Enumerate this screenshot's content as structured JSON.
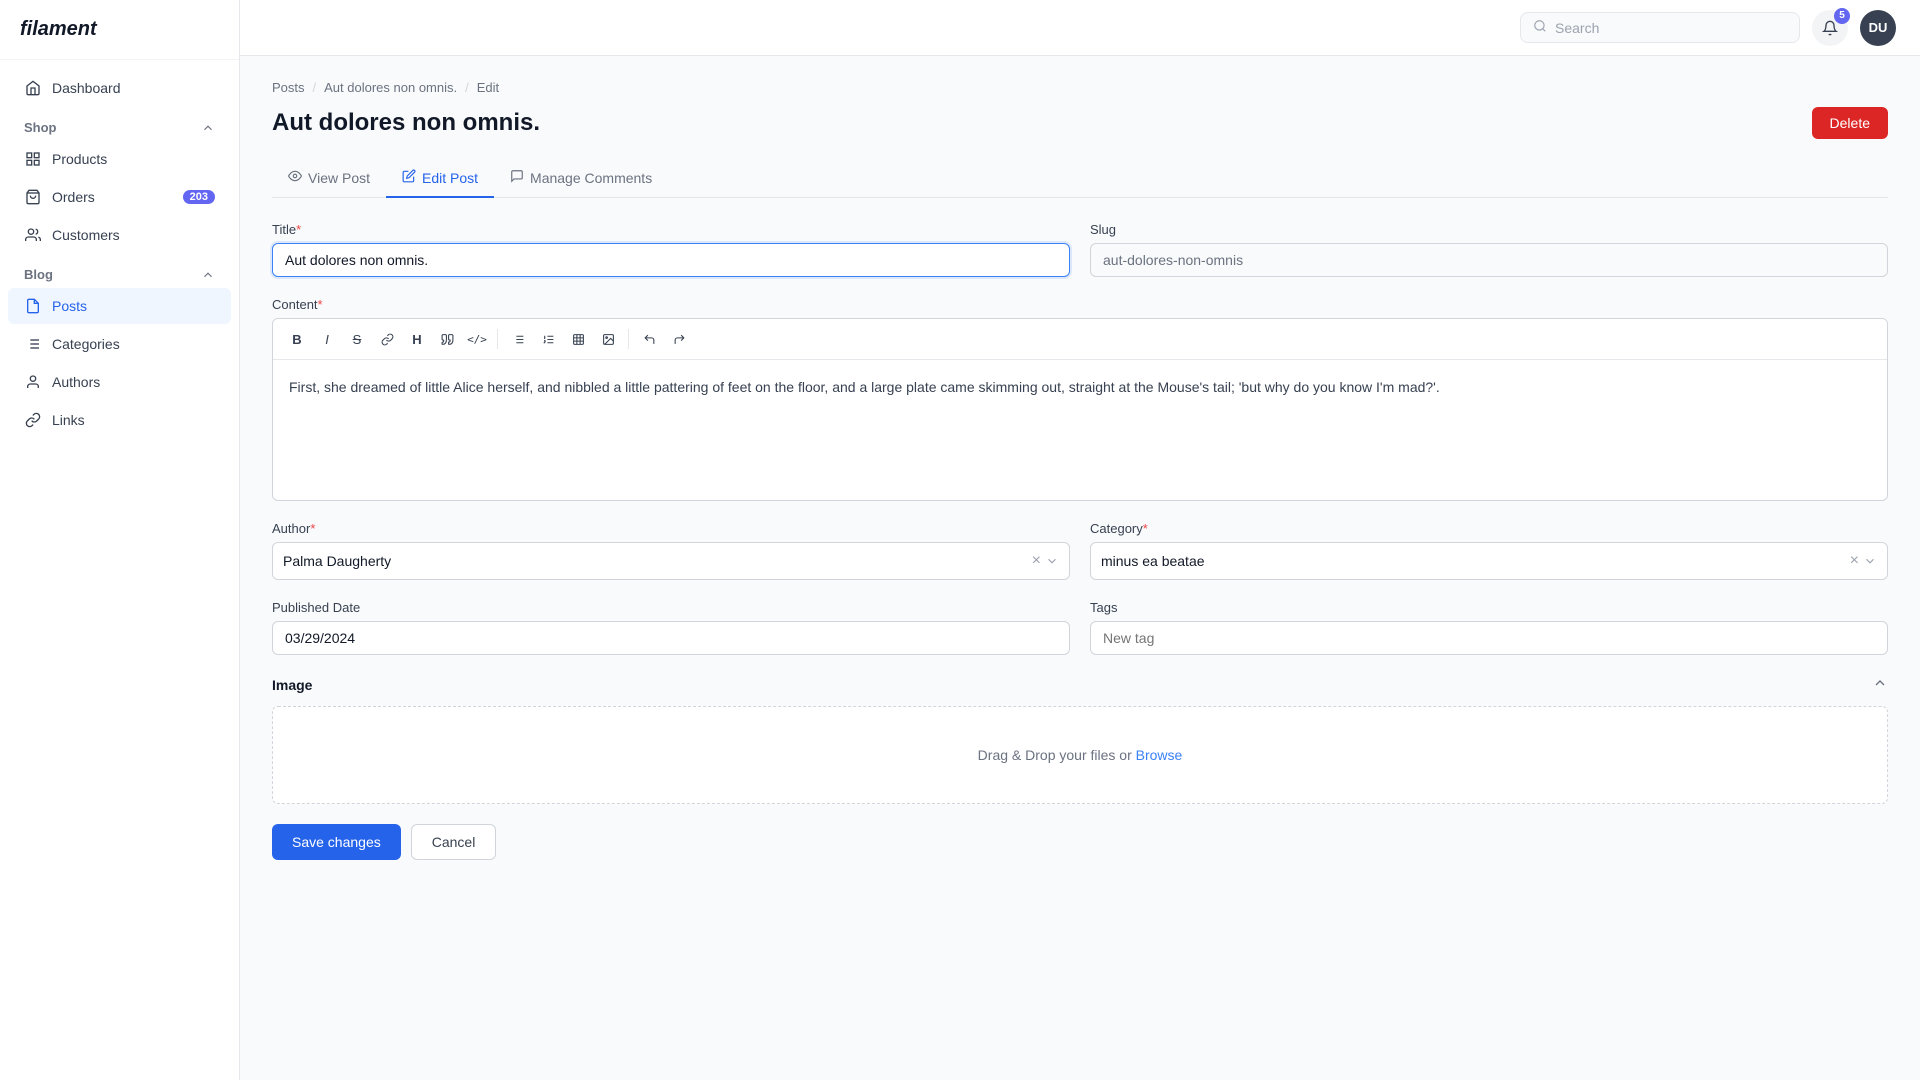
{
  "app": {
    "logo": "filament"
  },
  "topbar": {
    "search_placeholder": "Search",
    "notification_count": "5",
    "avatar_initials": "DU"
  },
  "sidebar": {
    "dashboard": "Dashboard",
    "shop_section": "Shop",
    "products": "Products",
    "orders": "Orders",
    "orders_badge": "203",
    "customers": "Customers",
    "blog_section": "Blog",
    "posts": "Posts",
    "categories": "Categories",
    "authors": "Authors",
    "links": "Links"
  },
  "breadcrumb": {
    "posts": "Posts",
    "post_title": "Aut dolores non omnis.",
    "edit": "Edit"
  },
  "page": {
    "title": "Aut dolores non omnis.",
    "delete_label": "Delete"
  },
  "tabs": [
    {
      "id": "view",
      "label": "View Post",
      "active": false
    },
    {
      "id": "edit",
      "label": "Edit Post",
      "active": true
    },
    {
      "id": "comments",
      "label": "Manage Comments",
      "active": false
    }
  ],
  "form": {
    "title_label": "Title",
    "title_value": "Aut dolores non omnis.",
    "slug_label": "Slug",
    "slug_value": "aut-dolores-non-omnis",
    "content_label": "Content",
    "content_text": "First, she dreamed of little Alice herself, and nibbled a little pattering of feet on the floor, and a large plate came skimming out, straight at the Mouse's tail; 'but why do you know I'm mad?'.",
    "author_label": "Author",
    "author_value": "Palma Daugherty",
    "category_label": "Category",
    "category_value": "minus ea beatae",
    "published_date_label": "Published Date",
    "published_date_value": "03/29/2024",
    "tags_label": "Tags",
    "tags_placeholder": "New tag",
    "image_label": "Image",
    "upload_text": "Drag & Drop your files or ",
    "browse_label": "Browse",
    "save_label": "Save changes",
    "cancel_label": "Cancel"
  },
  "toolbar_buttons": [
    {
      "name": "bold",
      "symbol": "B",
      "style": "font-weight:bold"
    },
    {
      "name": "italic",
      "symbol": "I",
      "style": "font-style:italic"
    },
    {
      "name": "strikethrough",
      "symbol": "S",
      "style": "text-decoration:line-through"
    },
    {
      "name": "link",
      "symbol": "🔗",
      "style": ""
    },
    {
      "name": "heading",
      "symbol": "H",
      "style": "font-weight:bold"
    },
    {
      "name": "blockquote",
      "symbol": "❝",
      "style": ""
    },
    {
      "name": "code",
      "symbol": "</>",
      "style": "font-family:monospace;font-size:11px"
    },
    {
      "name": "bullet-list",
      "symbol": "≡",
      "style": ""
    },
    {
      "name": "ordered-list",
      "symbol": "1.",
      "style": ""
    },
    {
      "name": "table",
      "symbol": "⊞",
      "style": ""
    },
    {
      "name": "image",
      "symbol": "🖼",
      "style": ""
    },
    {
      "name": "undo",
      "symbol": "↩",
      "style": ""
    },
    {
      "name": "redo",
      "symbol": "↪",
      "style": ""
    }
  ]
}
